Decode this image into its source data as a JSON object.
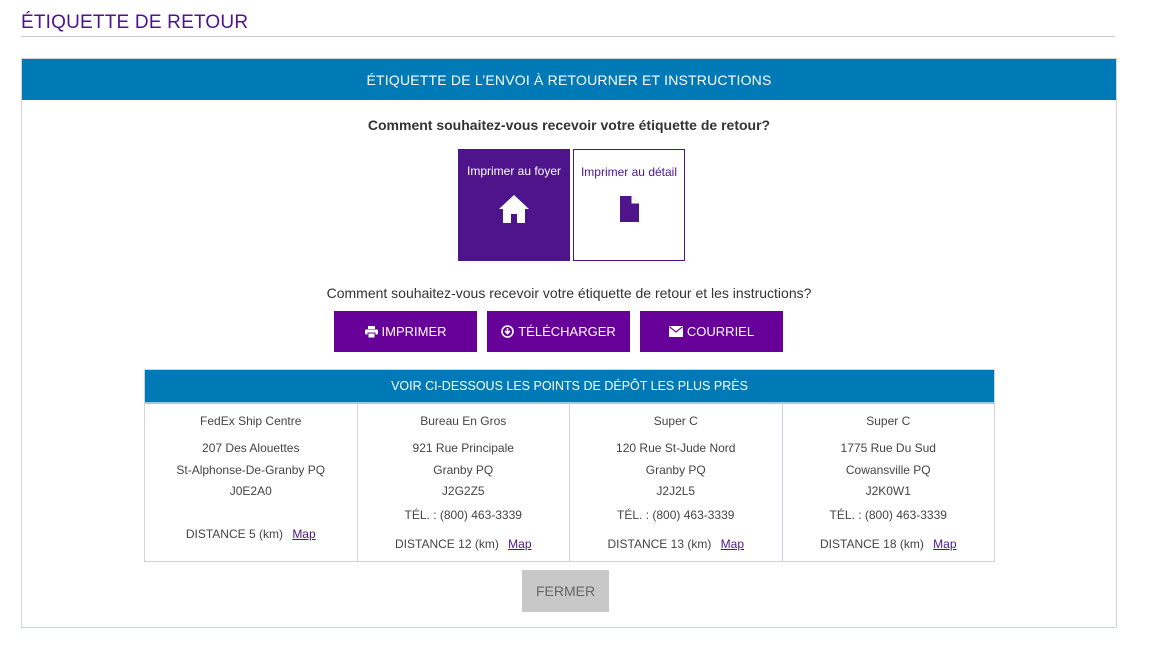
{
  "page": {
    "title": "ÉTIQUETTE DE RETOUR"
  },
  "panel": {
    "header": "ÉTIQUETTE DE L’ENVOI À RETOURNER ET INSTRUCTIONS",
    "question_receive_label": "Comment souhaitez-vous recevoir votre étiquette de retour?",
    "options": [
      {
        "label": "Imprimer au foyer",
        "icon": "home-icon",
        "selected": true
      },
      {
        "label": "Imprimer au détail",
        "icon": "document-icon",
        "selected": false
      }
    ],
    "question_receive_instructions": "Comment souhaitez-vous recevoir votre étiquette de retour et les instructions?",
    "actions": [
      {
        "label": "IMPRIMER",
        "icon": "printer-icon"
      },
      {
        "label": "TÉLÉCHARGER",
        "icon": "download-icon"
      },
      {
        "label": "COURRIEL",
        "icon": "envelope-icon"
      }
    ]
  },
  "dropoff": {
    "header": "VOIR CI-DESSOUS LES POINTS DE DÉPÔT LES PLUS PRÈS",
    "distance_label": "DISTANCE",
    "map_label": "Map",
    "locations": [
      {
        "name": "FedEx Ship Centre",
        "address": "207 Des Alouettes",
        "city": "St-Alphonse-De-Granby PQ",
        "postal": "J0E2A0",
        "phone": "",
        "distance": "5 (km)"
      },
      {
        "name": "Bureau En Gros",
        "address": "921 Rue Principale",
        "city": "Granby PQ",
        "postal": "J2G2Z5",
        "phone": "TÉL. : (800) 463-3339",
        "distance": "12 (km)"
      },
      {
        "name": "Super C",
        "address": "120 Rue St-Jude Nord",
        "city": "Granby PQ",
        "postal": "J2J2L5",
        "phone": "TÉL. : (800) 463-3339",
        "distance": "13 (km)"
      },
      {
        "name": "Super C",
        "address": "1775 Rue Du Sud",
        "city": "Cowansville PQ",
        "postal": "J2K0W1",
        "phone": "TÉL. : (800) 463-3339",
        "distance": "18 (km)"
      }
    ]
  },
  "close_label": "FERMER",
  "colors": {
    "purple": "#4d148c",
    "button_purple": "#670099",
    "blue": "#007ab7",
    "close_gray": "#c8c8c8"
  }
}
